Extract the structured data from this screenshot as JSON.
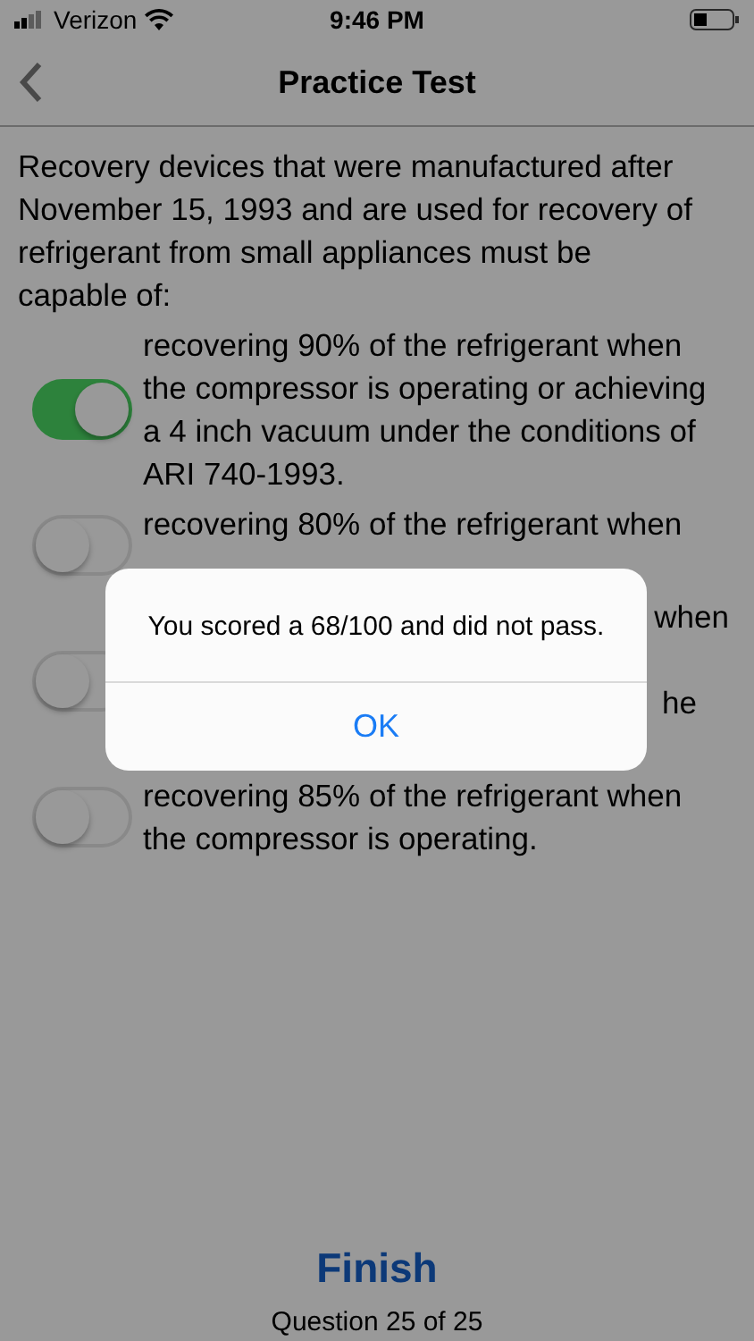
{
  "status_bar": {
    "carrier": "Verizon",
    "time": "9:46 PM"
  },
  "nav_bar": {
    "title": "Practice Test"
  },
  "question": "Recovery devices that were manufactured after November 15, 1993 and are used for recovery of refrigerant from small appliances must be capable of:",
  "options": [
    {
      "kind": "full",
      "text": "recovering 90% of the refrigerant when the compressor is operating or achieving a 4 inch vacuum under the conditions of ARI 740-1993.",
      "selected": true
    },
    {
      "kind": "full",
      "text": "recovering 80% of the refrigerant when",
      "selected": false
    },
    {
      "kind": "partial",
      "fragments": [
        "when",
        "he"
      ],
      "selected": false
    },
    {
      "kind": "full",
      "text": "recovering 85% of the refrigerant when the compressor is operating.",
      "selected": false
    }
  ],
  "finish_button": "Finish",
  "progress": "Question 25 of 25",
  "alert": {
    "message": "You scored a 68/100 and did not pass.",
    "button": "OK"
  }
}
